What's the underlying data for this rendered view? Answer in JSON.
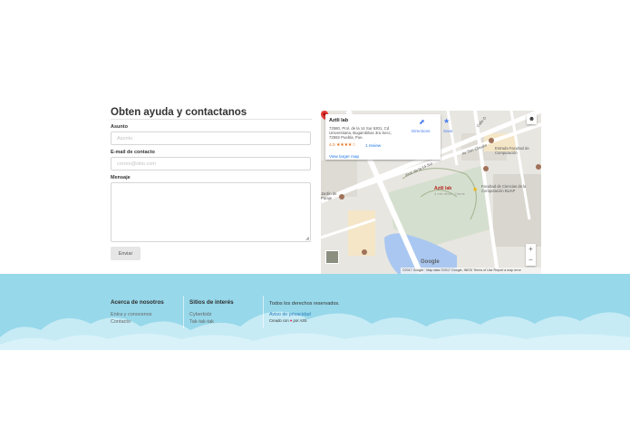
{
  "contact": {
    "title": "Obten ayuda y contactanos",
    "subject_label": "Asunto",
    "subject_placeholder": "Asunto",
    "email_label": "E-mail de contacto",
    "email_placeholder": "correo@sitio.com",
    "message_label": "Mensaje",
    "send_label": "Enviar"
  },
  "map": {
    "place_name": "Aztli lab",
    "address": "72580, Prol. de la 14 Sur 6301, Cd Universitaria, Bugambilias 3ra Secc, 72592 Puebla, Pue.",
    "rating": "4.0 ★★★★☆",
    "reviews": "1 review",
    "directions_label": "Directions",
    "save_label": "Save",
    "larger_map_label": "View larger map",
    "pin_label": "Aztli lab",
    "pin_sub": "4 min drive · Home",
    "labels": {
      "calle": "Calle D",
      "prol": "Prol. de la 14 Sur",
      "av": "Av San Claudio",
      "entrada": "Entrada Facultad de Computación",
      "facultad": "Facultad de Ciencias de la Computación BUAP",
      "parque": "Jardín de Paraje"
    },
    "footer_text": "©2017 Google · Map data ©2017 Google, INEGI   Terms of Use   Report a map error",
    "google": "Google",
    "zoom_in": "+",
    "zoom_out": "−"
  },
  "footer": {
    "about_title": "Acerca de nosotros",
    "about_links": [
      "Entra y conocenos",
      "Contacto"
    ],
    "sites_title": "Sitios de interés",
    "sites_links": [
      "Cyberkidz",
      "Tak-tak-tak"
    ],
    "rights": "Todos los derechos reservados.",
    "privacy": "Aviso de privacidad",
    "credit_prefix": "Creado con",
    "credit_suffix": "por Aztli"
  },
  "colors": {
    "footer_bg": "#97d8ea",
    "cloud": "#c6ebf5",
    "link": "#2a7fbf"
  }
}
